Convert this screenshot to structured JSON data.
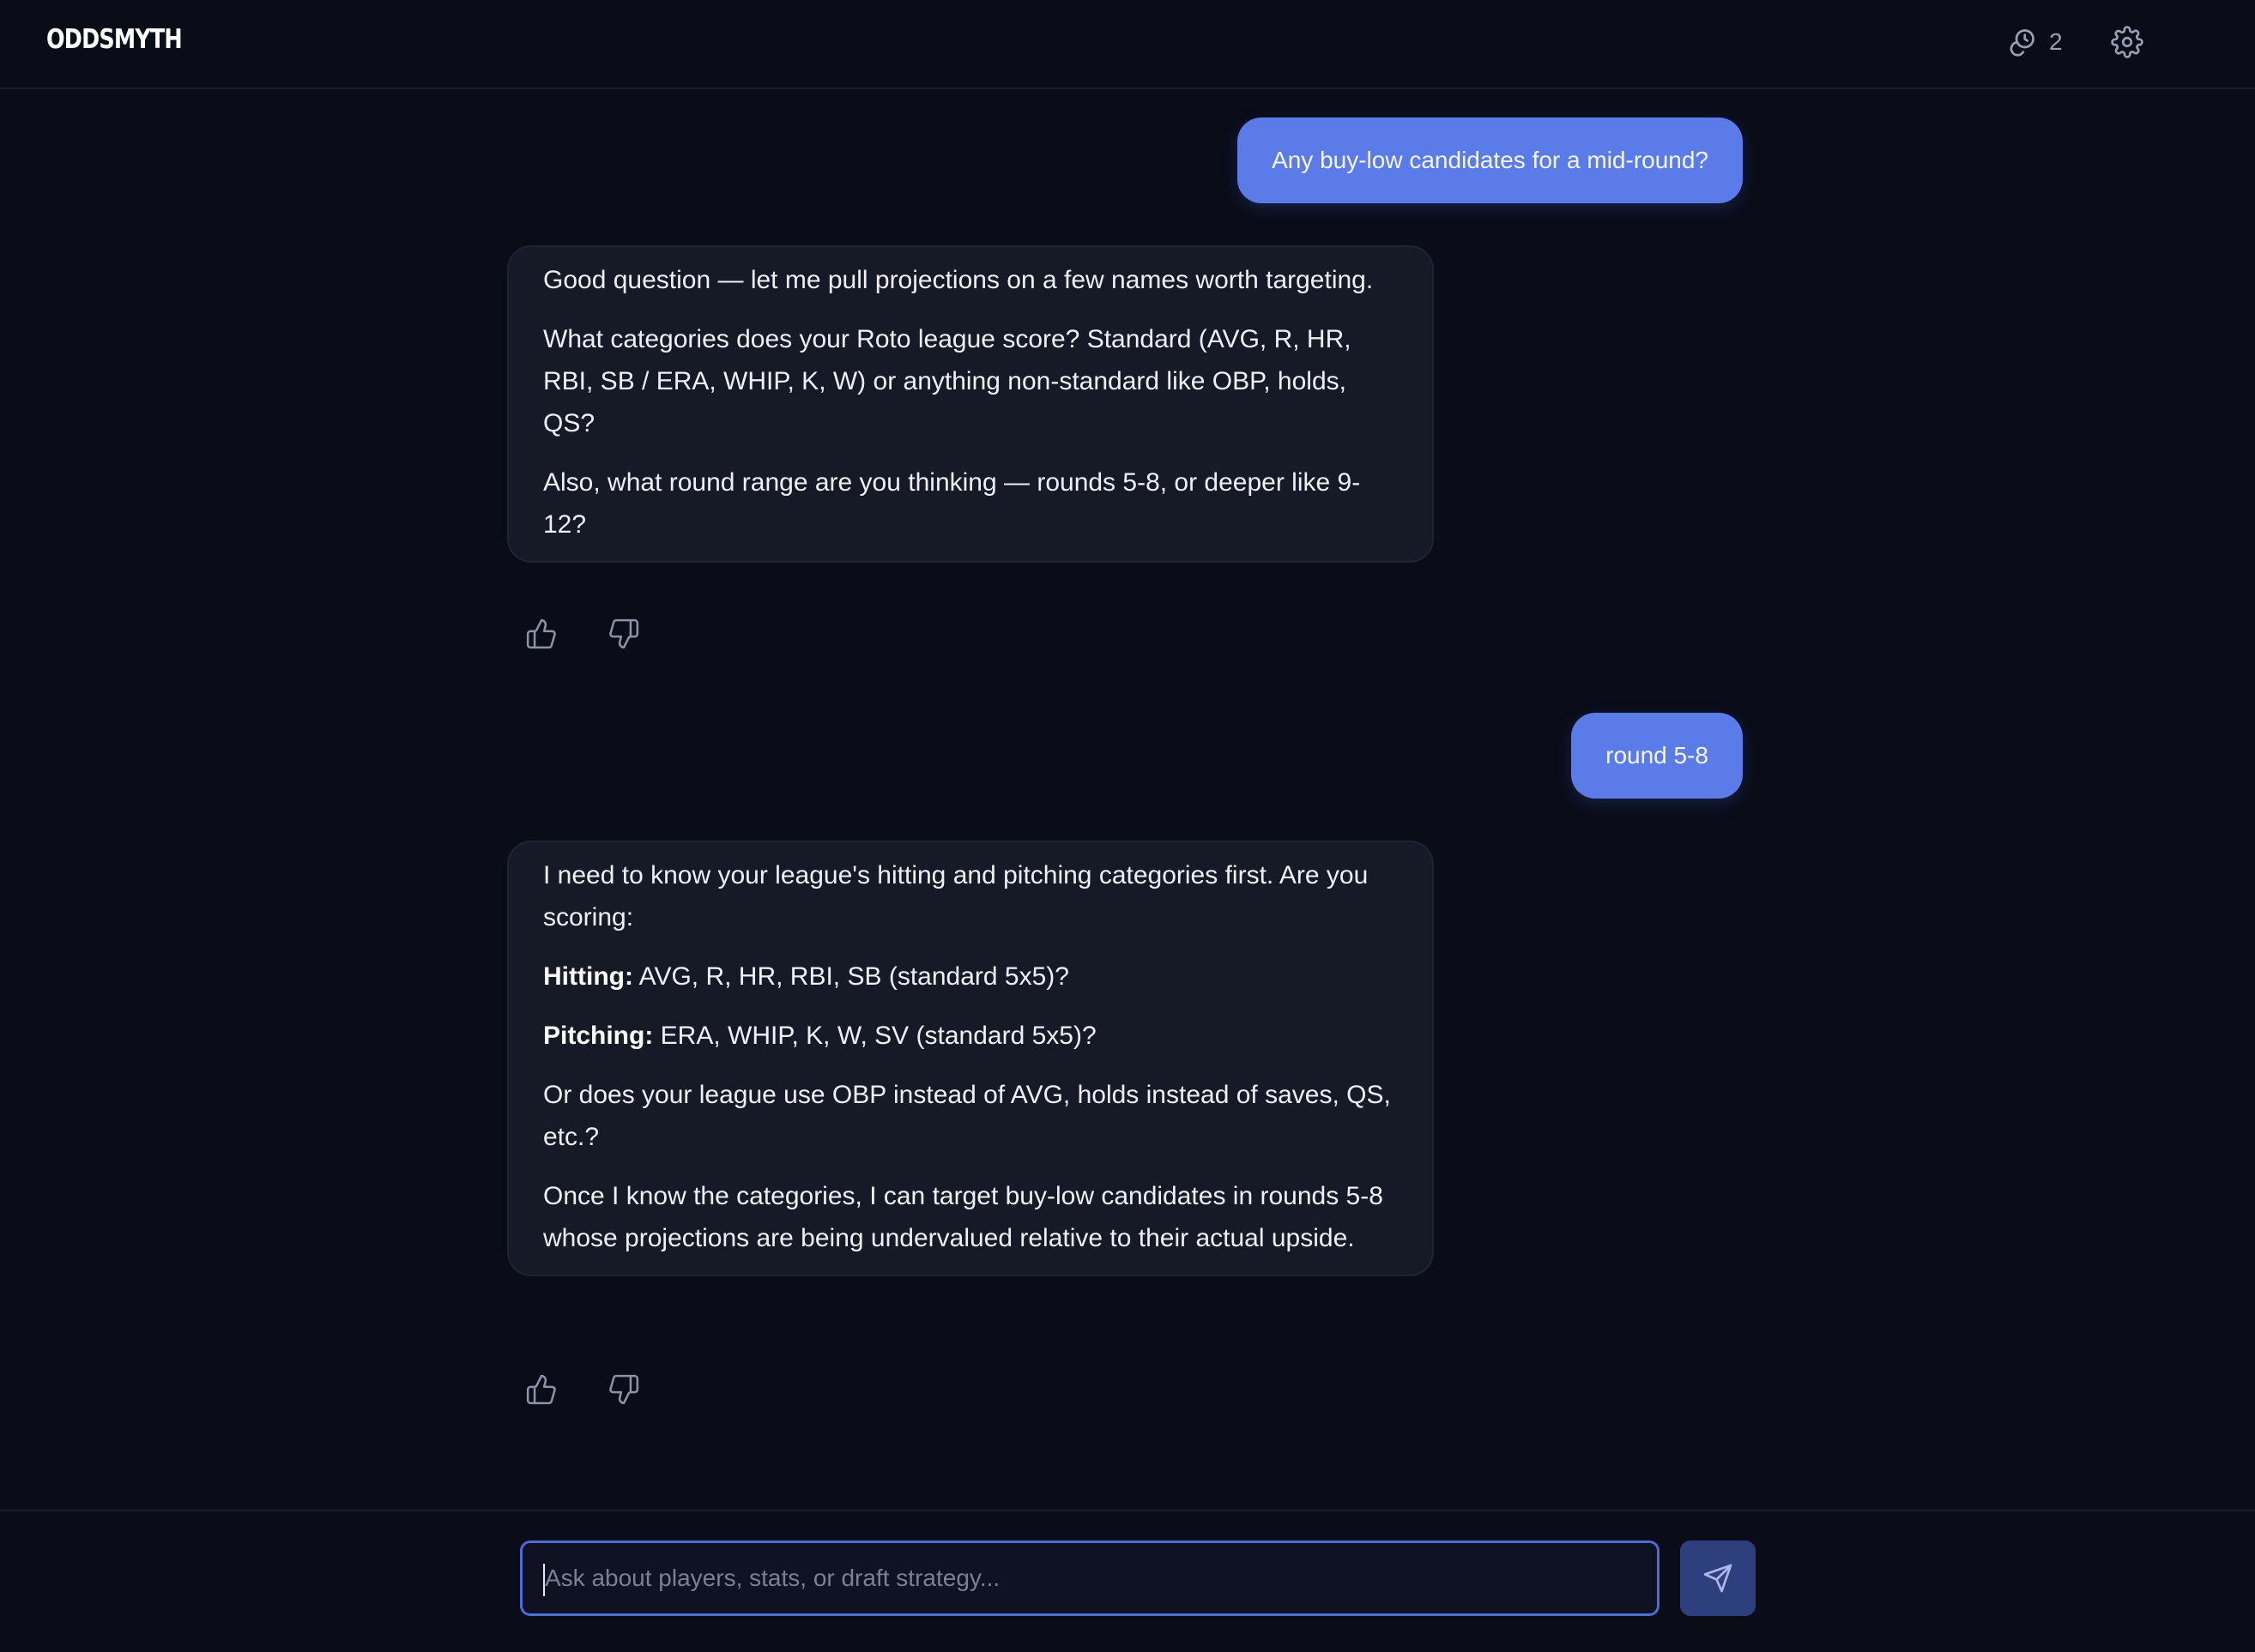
{
  "header": {
    "logo": "ODDSMYTH",
    "credits_count": "2",
    "credits_icon": "credits-icon",
    "settings_icon": "gear-icon"
  },
  "messages": [
    {
      "role": "user",
      "text": "Any buy-low candidates for a mid-round?"
    },
    {
      "role": "assistant",
      "paragraphs": [
        "Good question — let me pull projections on a few names worth targeting.",
        "What categories does your Roto league score? Standard (AVG, R, HR, RBI, SB / ERA, WHIP, K, W) or anything non-standard like OBP, holds, QS?",
        "Also, what round range are you thinking — rounds 5-8, or deeper like 9-12?"
      ]
    },
    {
      "role": "user",
      "text": "round 5-8"
    },
    {
      "role": "assistant",
      "paragraphs": [
        "I need to know your league's hitting and pitching categories first. Are you scoring:",
        "AVG, R, HR, RBI, SB (standard 5x5)?",
        "ERA, WHIP, K, W, SV (standard 5x5)?",
        "Or does your league use OBP instead of AVG, holds instead of saves, QS, etc.?",
        "Once I know the categories, I can target buy-low candidates in rounds 5-8 whose projections are being undervalued relative to their actual upside."
      ],
      "bold_labels": [
        "Hitting:",
        "Pitching:"
      ]
    }
  ],
  "feedback": {
    "thumbs_up_icon": "thumbs-up-icon",
    "thumbs_down_icon": "thumbs-down-icon"
  },
  "composer": {
    "placeholder": "Ask about players, stats, or draft strategy...",
    "value": "",
    "send_icon": "send-icon"
  },
  "colors": {
    "background": "#0a0c18",
    "user_bubble": "#5b7ce8",
    "assistant_bubble": "#161a27",
    "input_border": "#4f6bd8",
    "send_button": "#2e3f7e"
  }
}
